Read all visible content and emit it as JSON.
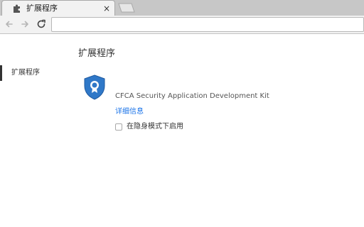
{
  "browser": {
    "tab": {
      "title": "扩展程序",
      "close_glyph": "×"
    },
    "toolbar": {
      "back_icon": "back-arrow-icon",
      "forward_icon": "forward-arrow-icon",
      "reload_icon": "reload-icon",
      "omnibox_value": ""
    }
  },
  "sidebar": {
    "items": [
      {
        "label": "扩展程序",
        "selected": true
      }
    ]
  },
  "main": {
    "title": "扩展程序",
    "extension": {
      "name": "CFCA Security Application Development Kit",
      "details_link": "详细信息",
      "incognito_label": "在隐身模式下启用",
      "incognito_checked": false,
      "icon": "shield-badge-icon"
    }
  },
  "colors": {
    "tabstrip": "#c7c7c7",
    "toolbar": "#f2f2f2",
    "link": "#1a73e8",
    "shield": "#2f78c8"
  }
}
